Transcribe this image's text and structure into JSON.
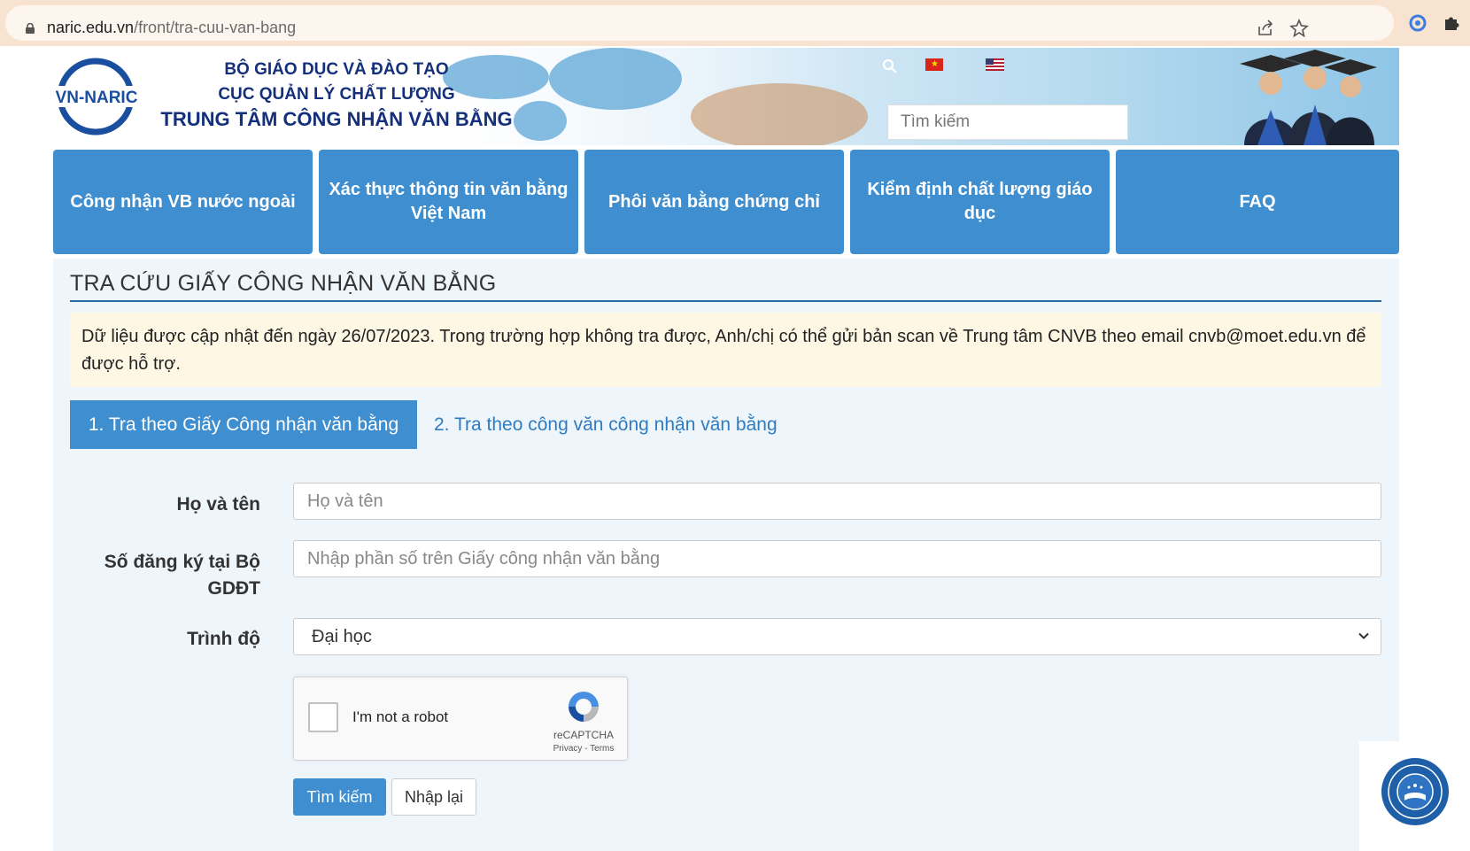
{
  "browser": {
    "url_domain": "naric.edu.vn",
    "url_path": "/front/tra-cuu-van-bang"
  },
  "header": {
    "logo_text": "VN-NARIC",
    "org_line1": "BỘ GIÁO DỤC VÀ ĐÀO TẠO",
    "org_line2": "CỤC QUẢN LÝ CHẤT LƯỢNG",
    "org_line3": "TRUNG TÂM CÔNG NHẬN VĂN BẰNG",
    "search_placeholder": "Tìm kiếm"
  },
  "nav": [
    {
      "label": "Công nhận VB nước ngoài"
    },
    {
      "label": "Xác thực thông tin văn bằng Việt Nam"
    },
    {
      "label": "Phôi văn bằng chứng chỉ"
    },
    {
      "label": "Kiểm định chất lượng giáo dục"
    },
    {
      "label": "FAQ"
    }
  ],
  "main": {
    "title": "TRA CỨU GIẤY CÔNG NHẬN VĂN BẰNG",
    "notice": "Dữ liệu được cập nhật đến ngày 26/07/2023. Trong trường hợp không tra được, Anh/chị có thể gửi bản scan về Trung tâm CNVB theo email cnvb@moet.edu.vn để được hỗ trợ.",
    "tabs": [
      {
        "label": "1. Tra theo Giấy Công nhận văn bằng",
        "active": true
      },
      {
        "label": "2. Tra theo công văn công nhận văn bằng",
        "active": false
      }
    ],
    "form": {
      "name_label": "Họ và tên",
      "name_placeholder": "Họ và tên",
      "reg_label": "Số đăng ký tại Bộ GDĐT",
      "reg_placeholder": "Nhập phần số trên Giấy công nhận văn bằng",
      "level_label": "Trình độ",
      "level_value": "Đại học"
    },
    "captcha": {
      "label": "I'm not a robot",
      "brand": "reCAPTCHA",
      "links": "Privacy - Terms"
    },
    "buttons": {
      "search": "Tìm kiếm",
      "reset": "Nhập lại"
    }
  },
  "colors": {
    "primary": "#3e8ed0",
    "navy": "#14307a",
    "notice_bg": "#fdf7e4",
    "panel_bg": "#eef5fb"
  }
}
